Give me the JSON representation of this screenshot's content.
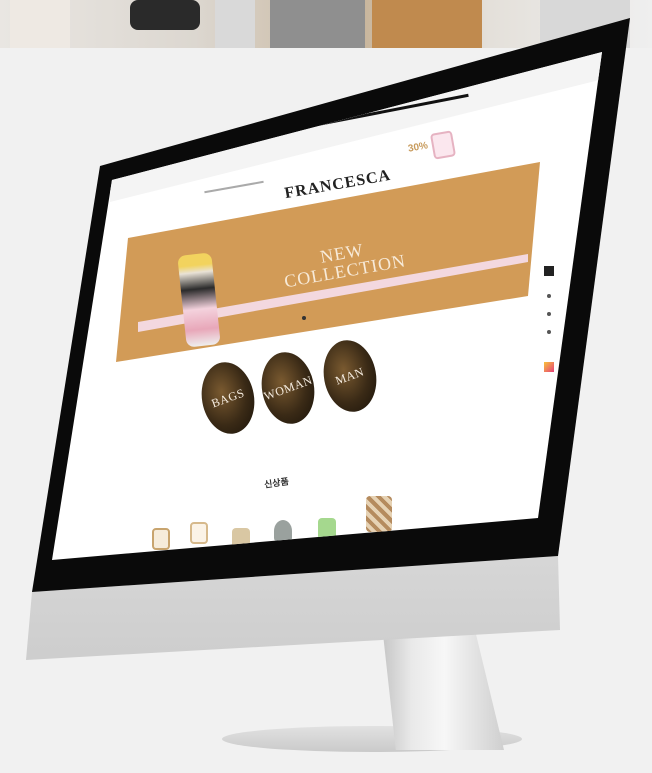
{
  "website": {
    "logo": "FRANCESCA",
    "promo_percent": "30%",
    "hero": {
      "title_line1": "NEW",
      "title_line2": "COLLECTION"
    },
    "categories": [
      {
        "label": "BAGS"
      },
      {
        "label": "WOMAN"
      },
      {
        "label": "MAN"
      }
    ],
    "section_title": "신상품"
  },
  "colors": {
    "hero_accent": "#d29b57",
    "hero_stripe": "#f3d8df",
    "bezel": "#0a0a0a"
  }
}
